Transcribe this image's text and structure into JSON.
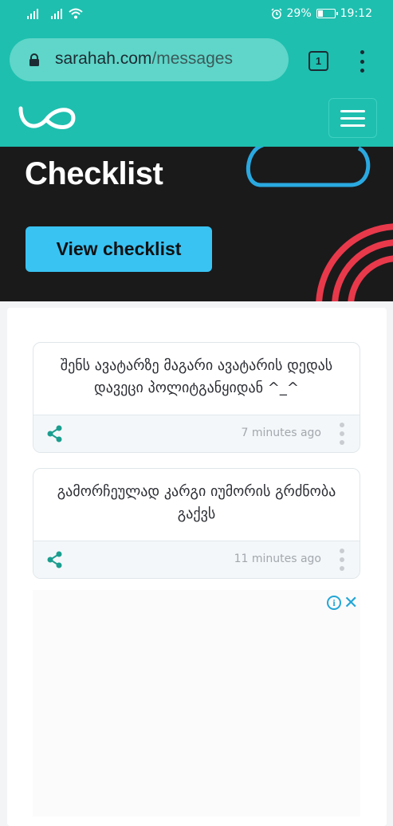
{
  "status_bar": {
    "battery": "29%",
    "time": "19:12",
    "battery_level": 0.29
  },
  "browser": {
    "url_host": "sarahah.com",
    "url_path": "/messages",
    "tab_count": "1"
  },
  "banner": {
    "title": "Checklist",
    "button": "View checklist"
  },
  "messages": [
    {
      "text": "შენს ავატარზე მაგარი ავატარის დედას დავეცი პოლიტგანყიდან ^_^",
      "time": "7 minutes ago"
    },
    {
      "text": "გამორჩეულად კარგი იუმორის გრძნობა გაქვს",
      "time": "11 minutes ago"
    }
  ],
  "ad": {
    "info_icon": "i",
    "close_icon": "✕"
  },
  "colors": {
    "brand": "#1ebfaf",
    "button": "#39c3f3",
    "banner_bg": "#1a1a1b"
  }
}
